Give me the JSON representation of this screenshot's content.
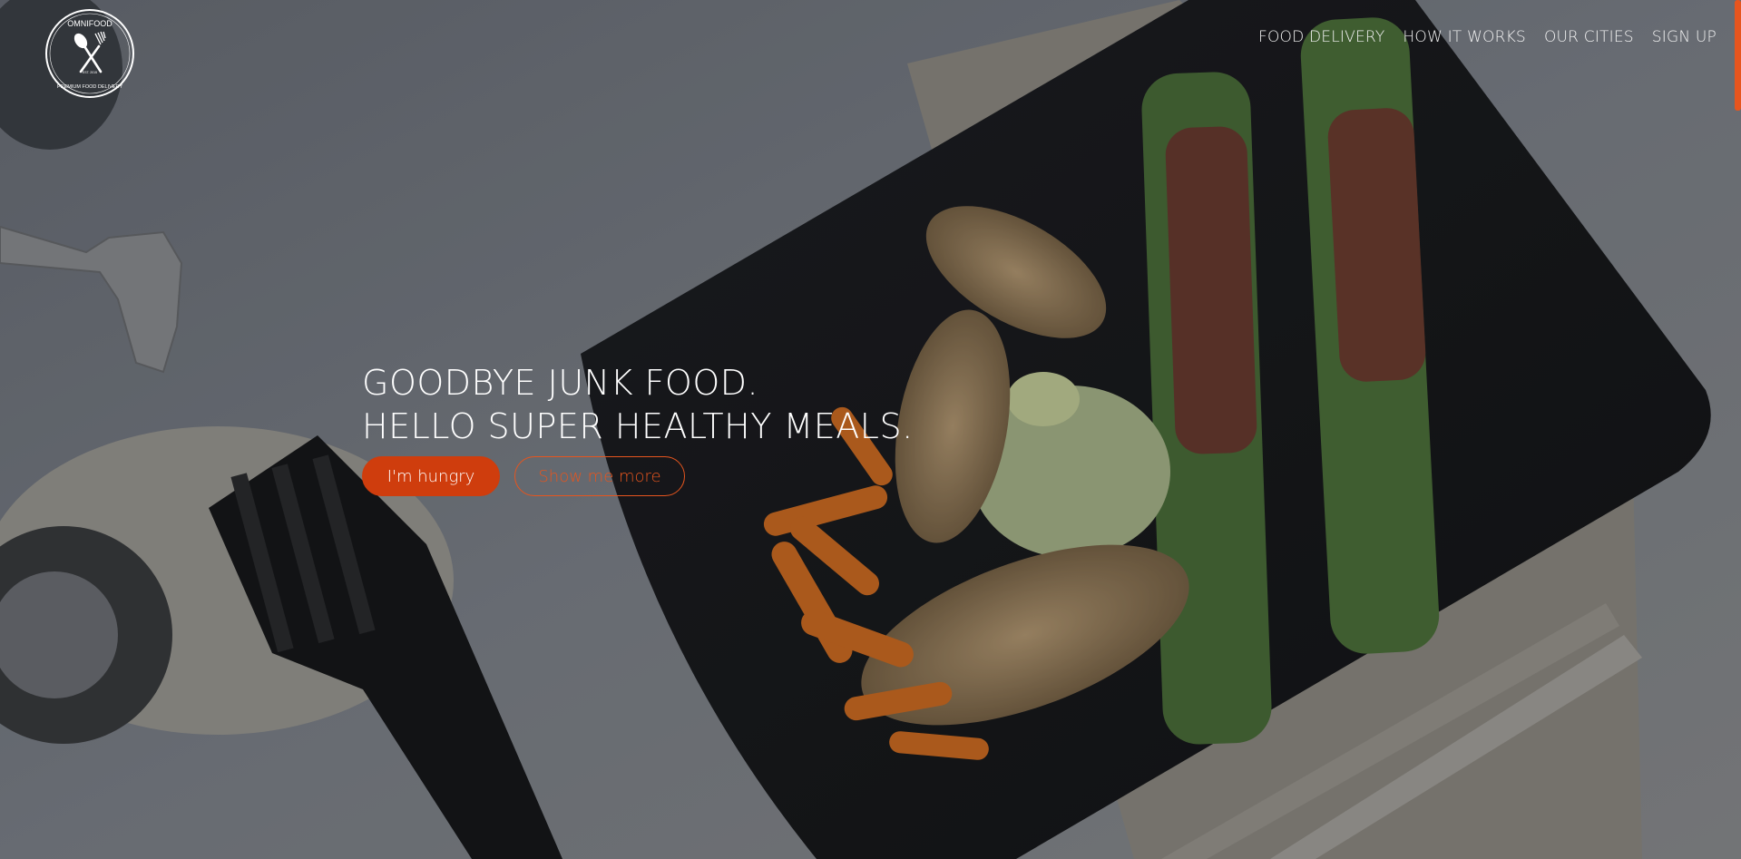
{
  "logo": {
    "top_text": "OMNIFOOD",
    "bottom_text": "PREMIUM FOOD DELIVERY",
    "est_text": "EST. 2015"
  },
  "nav": {
    "items": [
      {
        "label": "FOOD DELIVERY"
      },
      {
        "label": "HOW IT WORKS"
      },
      {
        "label": "OUR CITIES"
      },
      {
        "label": "SIGN UP"
      }
    ]
  },
  "hero": {
    "headline_line1": "GOODBYE JUNK FOOD.",
    "headline_line2": "HELLO SUPER HEALTHY MEALS.",
    "primary_button": "I'm hungry",
    "secondary_button": "Show me more"
  },
  "colors": {
    "accent": "#e6551e",
    "button_fill": "#cf3d0d",
    "text": "#ffffff"
  }
}
